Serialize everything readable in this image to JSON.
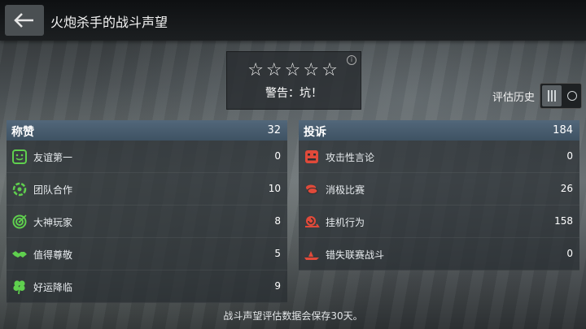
{
  "header": {
    "title": "火炮杀手的战斗声望",
    "back_icon": "back-arrow-icon"
  },
  "rating": {
    "stars": "☆☆☆☆☆",
    "star_count": 0,
    "star_max": 5,
    "warning": "警告：坑！",
    "info_icon": "info-icon"
  },
  "history": {
    "label": "评估历史"
  },
  "praise": {
    "title": "称赞",
    "total": "32",
    "items": [
      {
        "label": "友谊第一",
        "value": "0",
        "icon": "smiley-icon"
      },
      {
        "label": "团队合作",
        "value": "10",
        "icon": "team-circle-icon"
      },
      {
        "label": "大神玩家",
        "value": "8",
        "icon": "target-icon"
      },
      {
        "label": "值得尊敬",
        "value": "5",
        "icon": "handshake-icon"
      },
      {
        "label": "好运降临",
        "value": "9",
        "icon": "clover-icon"
      }
    ]
  },
  "complaints": {
    "title": "投诉",
    "total": "184",
    "items": [
      {
        "label": "攻击性言论",
        "value": "0",
        "icon": "angry-face-icon"
      },
      {
        "label": "消极比赛",
        "value": "26",
        "icon": "stack-icon"
      },
      {
        "label": "挂机行为",
        "value": "158",
        "icon": "snail-icon"
      },
      {
        "label": "错失联赛战斗",
        "value": "0",
        "icon": "missed-ship-icon"
      }
    ]
  },
  "footer": {
    "note": "战斗声望评估数据会保存30天。"
  },
  "colors": {
    "praise_icon": "#5fcf4e",
    "complaint_icon": "#e04a3a",
    "header_bar": "#4a5f71"
  }
}
